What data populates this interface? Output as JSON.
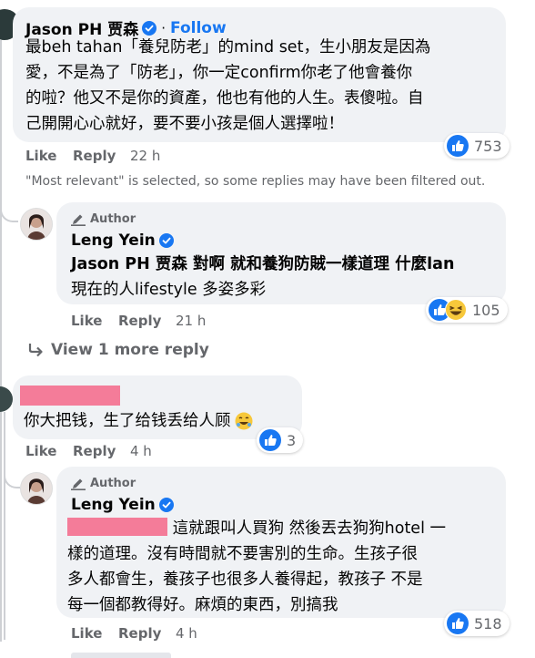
{
  "comment1": {
    "name": "Jason PH 贾森",
    "follow_label": "Follow",
    "lines": [
      "最beh tahan「養兒防老」的mind set，生小朋友是因為",
      "愛，不是為了「防老」，你一定confirm你老了他會養你",
      "的啦？他又不是你的資產，他也有他的人生。表傻啦。自",
      "己開開心心就好，要不要小孩是個人選擇啦！"
    ],
    "like_label": "Like",
    "reply_label": "Reply",
    "time": "22 h",
    "reaction_count": "753"
  },
  "filter_notice": "\"Most relevant\" is selected, so some replies may have been filtered out.",
  "reply1": {
    "author_tag": "Author",
    "name": "Leng Yein",
    "lines": [
      "Jason PH 贾森 對啊 就和養狗防賊一樣道理 什麼lan",
      "現在的人lifestyle 多姿多彩"
    ],
    "like_label": "Like",
    "reply_label": "Reply",
    "time": "21 h",
    "reaction_count": "105"
  },
  "view_more_label": "View 1 more reply",
  "comment2": {
    "text": "你大把钱，生了给钱丢给人顾",
    "like_label": "Like",
    "reply_label": "Reply",
    "time": "4 h",
    "reaction_count": "3"
  },
  "reply2": {
    "author_tag": "Author",
    "name": "Leng Yein",
    "first_line": "這就跟叫人買狗 然後丟去狗狗hotel 一",
    "lines": [
      "樣的道理。沒有時間就不要害別的生命。生孩子很",
      "多人都會生，養孩子也很多人養得起，教孩子 不是",
      "每一個都教得好。麻煩的東西，別搞我"
    ],
    "like_label": "Like",
    "reply_label": "Reply",
    "time": "4 h",
    "reaction_count": "518"
  },
  "colors": {
    "bubble": "#f0f2f5",
    "link_blue": "#1877f2",
    "muted": "#65676b",
    "redaction": "#f47c99"
  }
}
